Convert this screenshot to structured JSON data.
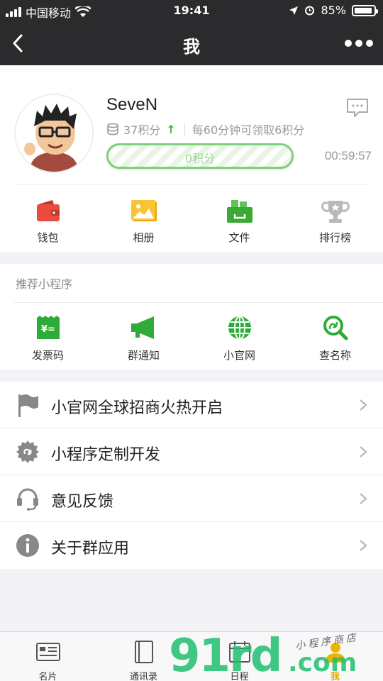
{
  "status_bar": {
    "carrier": "中国移动",
    "time": "19:41",
    "battery": "85%"
  },
  "nav": {
    "title": "我"
  },
  "profile": {
    "username": "SeveN",
    "points": "37积分",
    "points_hint": "每60分钟可领取6积分",
    "progress_label": "0积分",
    "progress_fraction": 0,
    "countdown": "00:59:57"
  },
  "quick_actions": [
    {
      "label": "钱包",
      "icon": "wallet-icon"
    },
    {
      "label": "相册",
      "icon": "album-icon"
    },
    {
      "label": "文件",
      "icon": "file-icon"
    },
    {
      "label": "排行榜",
      "icon": "trophy-icon"
    }
  ],
  "mini_programs": {
    "header": "推荐小程序",
    "items": [
      {
        "label": "发票码",
        "icon": "invoice-icon"
      },
      {
        "label": "群通知",
        "icon": "megaphone-icon"
      },
      {
        "label": "小官网",
        "icon": "globe-icon"
      },
      {
        "label": "查名称",
        "icon": "search-name-icon"
      }
    ]
  },
  "menu": [
    {
      "label": "小官网全球招商火热开启",
      "icon": "flag-icon"
    },
    {
      "label": "小程序定制开发",
      "icon": "gear-icon"
    },
    {
      "label": "意见反馈",
      "icon": "headset-icon"
    },
    {
      "label": "关于群应用",
      "icon": "info-icon"
    }
  ],
  "tabs": [
    {
      "label": "名片",
      "icon": "card-icon"
    },
    {
      "label": "通讯录",
      "icon": "contacts-icon"
    },
    {
      "label": "日程",
      "icon": "calendar-icon"
    },
    {
      "label": "我",
      "icon": "me-icon"
    }
  ],
  "watermark": {
    "big": "91rd",
    "com": ".com",
    "small": "小程序商店"
  },
  "colors": {
    "header": "#2b2b2d",
    "accent_green": "#41b83e",
    "active_tab": "#e6a700"
  }
}
